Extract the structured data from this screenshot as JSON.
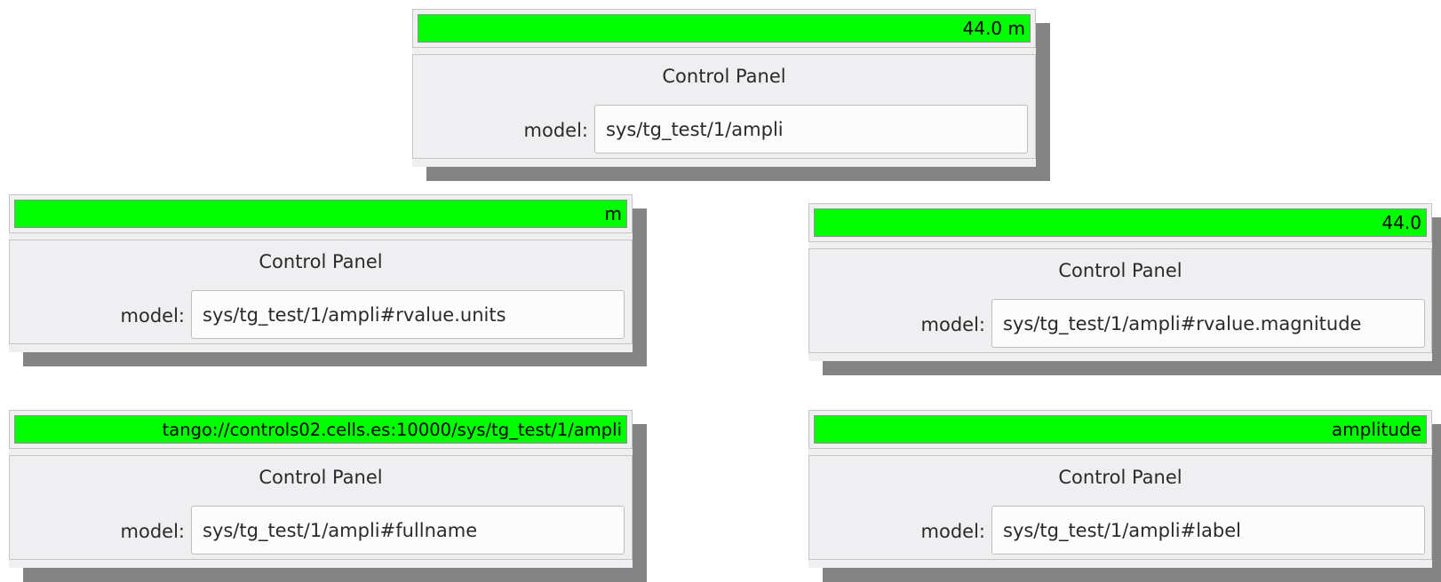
{
  "widgets": [
    {
      "label": "44.0 m",
      "title": "Control Panel",
      "model_label": "model:",
      "model_value": "sys/tg_test/1/ampli"
    },
    {
      "label": "m",
      "title": "Control Panel",
      "model_label": "model:",
      "model_value": "sys/tg_test/1/ampli#rvalue.units"
    },
    {
      "label": "44.0",
      "title": "Control Panel",
      "model_label": "model:",
      "model_value": "sys/tg_test/1/ampli#rvalue.magnitude"
    },
    {
      "label": "tango://controls02.cells.es:10000/sys/tg_test/1/ampli",
      "title": "Control Panel",
      "model_label": "model:",
      "model_value": "sys/tg_test/1/ampli#fullname"
    },
    {
      "label": "amplitude",
      "title": "Control Panel",
      "model_label": "model:",
      "model_value": "sys/tg_test/1/ampli#label"
    }
  ],
  "colors": {
    "label_background": "#00ff00",
    "shadow": "#848484",
    "panel_background": "#efeff1"
  }
}
